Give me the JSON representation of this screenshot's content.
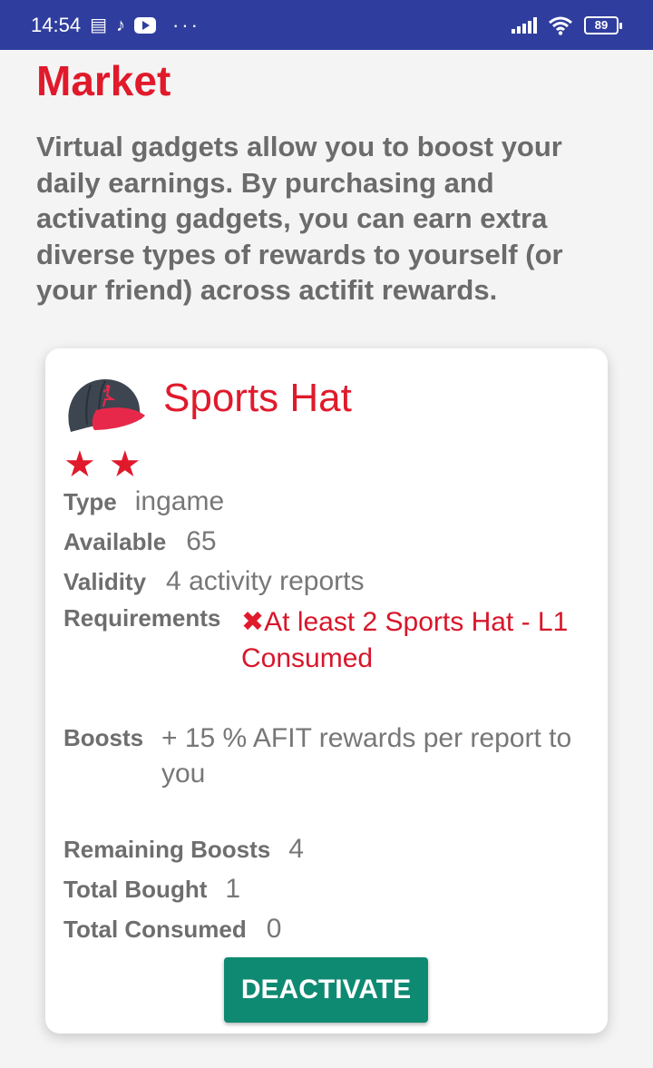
{
  "status_bar": {
    "time": "14:54",
    "battery": "89",
    "icons": [
      "notification-icon",
      "tiktok-icon",
      "youtube-icon",
      "more-dots-icon",
      "signal-icon",
      "wifi-icon",
      "battery-icon"
    ]
  },
  "page": {
    "title": "Market",
    "intro": "Virtual gadgets allow you to boost your daily earnings. By purchasing and activating gadgets, you can earn extra diverse types of rewards to yourself (or your friend) across actifit rewards."
  },
  "gadget": {
    "name": "Sports Hat",
    "stars": 2,
    "type_label": "Type",
    "type_value": "ingame",
    "available_label": "Available",
    "available_value": "65",
    "validity_label": "Validity",
    "validity_value": "4 activity reports",
    "requirements_label": "Requirements",
    "requirements_mark": "✖",
    "requirements_value": "At least 2 Sports Hat - L1 Consumed",
    "boosts_label": "Boosts",
    "boosts_value": "+ 15 % AFIT rewards per report to you",
    "remaining_label": "Remaining Boosts",
    "remaining_value": "4",
    "bought_label": "Total Bought",
    "bought_value": "1",
    "consumed_label": "Total Consumed",
    "consumed_value": "0",
    "button_label": "DEACTIVATE"
  },
  "colors": {
    "status_bar": "#2f3e9e",
    "accent_red": "#e01a2b",
    "button_teal": "#0f8a72"
  }
}
